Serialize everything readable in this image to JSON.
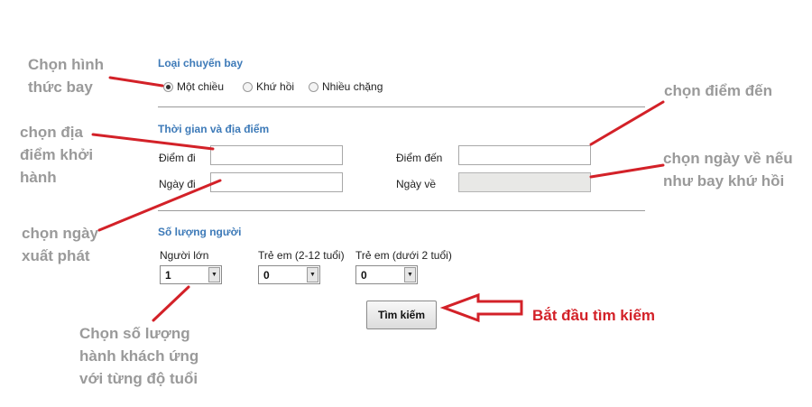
{
  "trip_type": {
    "title": "Loại chuyến bay",
    "options": [
      "Một chiều",
      "Khứ hồi",
      "Nhiều chặng"
    ],
    "selected": "Một chiều"
  },
  "time_place": {
    "title": "Thời gian và địa điểm",
    "from_label": "Điểm đi",
    "to_label": "Điểm đến",
    "depart_label": "Ngày đi",
    "return_label": "Ngày về",
    "from_value": "",
    "to_value": "",
    "depart_value": "",
    "return_value": ""
  },
  "passengers": {
    "title": "Số lượng người",
    "adult_label": "Người lớn",
    "child_label": "Trẻ em (2-12 tuổi)",
    "infant_label": "Trẻ em (dưới 2 tuổi)",
    "adult_value": "1",
    "child_value": "0",
    "infant_value": "0"
  },
  "search_button": "Tìm kiếm",
  "annotations": {
    "trip_type": [
      "Chọn hình",
      "thức bay"
    ],
    "origin": [
      "chọn địa",
      "điểm khởi",
      "hành"
    ],
    "depart_date": [
      "chọn ngày",
      "xuất phát"
    ],
    "destination": "chọn điểm đến",
    "return_date": [
      "chọn ngày về nếu",
      "như bay khứ hồi"
    ],
    "passengers": [
      "Chọn số lượng",
      "hành khách ứng",
      "với từng độ tuổi"
    ],
    "start_search": "Bắt đầu tìm kiếm"
  },
  "colors": {
    "section_title": "#3d7ab8",
    "annotation_gray": "#9a9a9a",
    "annotation_red": "#d32128",
    "arrow_line": "#d32128"
  }
}
